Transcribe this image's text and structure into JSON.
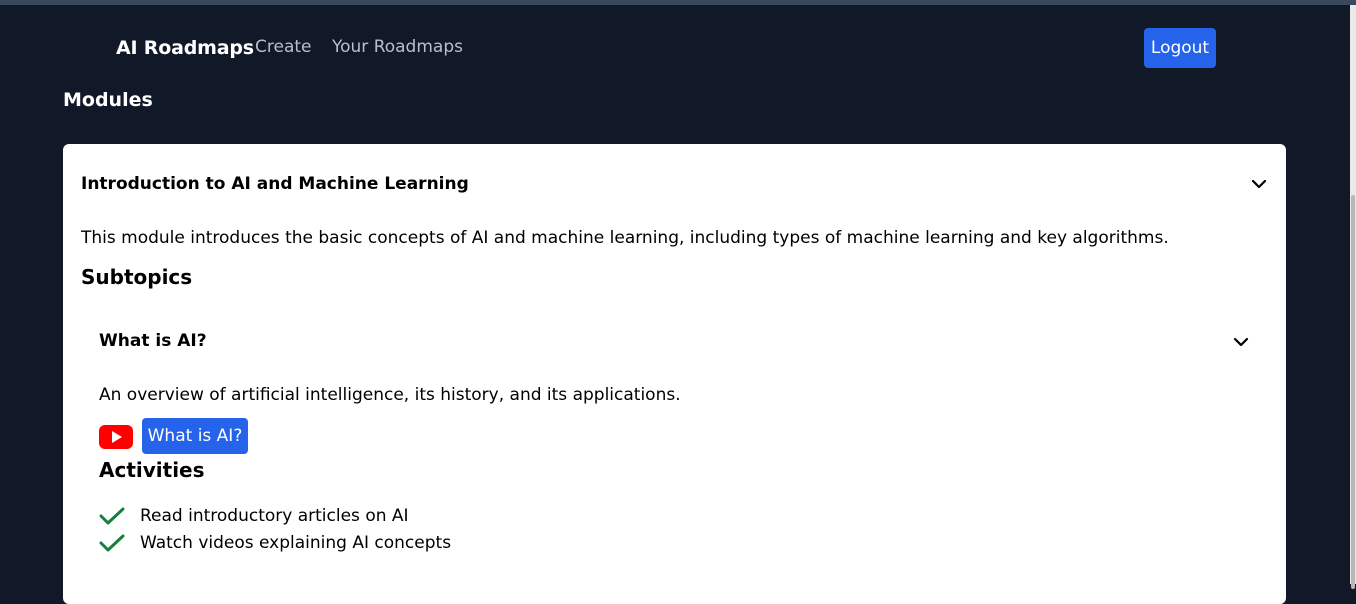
{
  "nav": {
    "brand": "AI Roadmaps",
    "links": [
      "Create",
      "Your Roadmaps"
    ],
    "logout_label": "Logout"
  },
  "page": {
    "section_title": "Modules"
  },
  "module": {
    "title": "Introduction to AI and Machine Learning",
    "description": "This module introduces the basic concepts of AI and machine learning, including types of machine learning and key algorithms.",
    "subtopics_heading": "Subtopics",
    "subtopic": {
      "title": "What is AI?",
      "description": "An overview of artificial intelligence, its history, and its applications.",
      "video_label": "What is AI?",
      "activities_heading": "Activities",
      "activities": [
        "Read introductory articles on AI",
        "Watch videos explaining AI concepts"
      ]
    }
  },
  "colors": {
    "background": "#111827",
    "accent": "#2563eb",
    "check": "#15803d",
    "youtube": "#ff0000"
  },
  "icons": [
    "chevron-down-icon",
    "youtube-icon",
    "check-icon"
  ]
}
